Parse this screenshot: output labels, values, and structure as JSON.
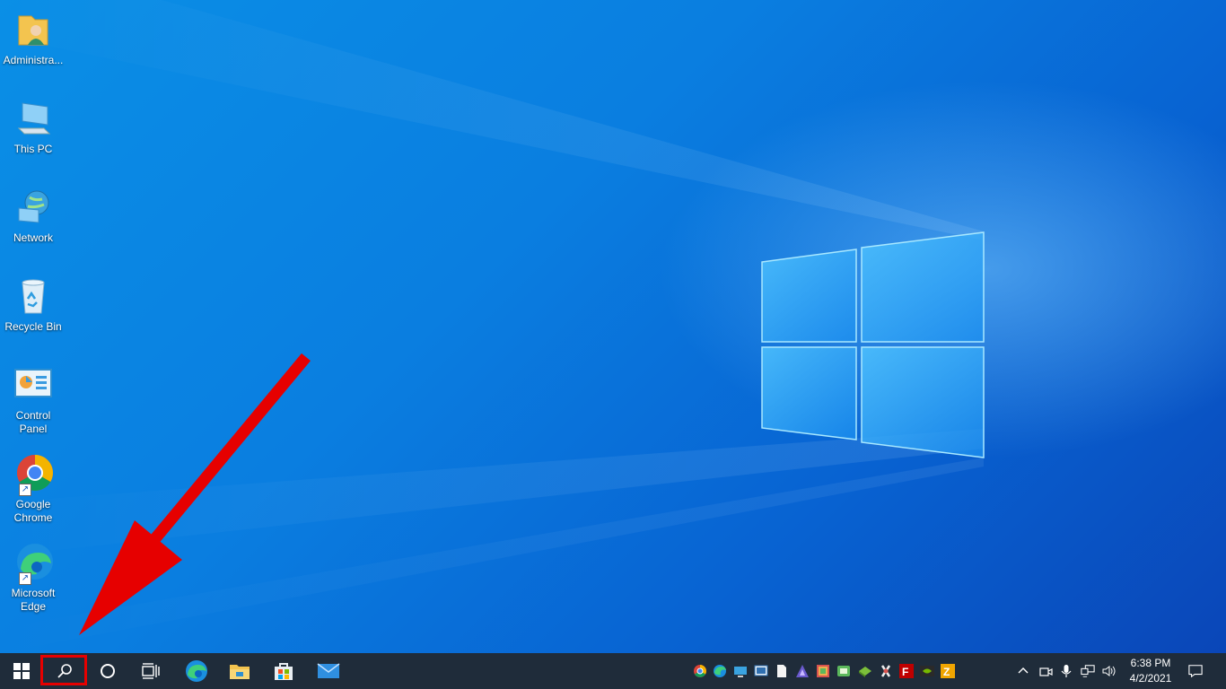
{
  "desktop": {
    "icons": [
      {
        "label": "Administra...",
        "icon": "user-folder-icon"
      },
      {
        "label": "This PC",
        "icon": "computer-icon"
      },
      {
        "label": "Network",
        "icon": "network-icon"
      },
      {
        "label": "Recycle Bin",
        "icon": "recycle-bin-icon"
      },
      {
        "label": "Control Panel",
        "icon": "control-panel-icon"
      },
      {
        "label": "Google Chrome",
        "icon": "chrome-icon"
      },
      {
        "label": "Microsoft Edge",
        "icon": "edge-icon"
      }
    ]
  },
  "annotation": {
    "color": "#e60000",
    "target": "search-button"
  },
  "taskbar": {
    "start": "windows-start-icon",
    "search": "search-icon",
    "cortana": "cortana-circle-icon",
    "task_view": "task-view-icon",
    "pinned": [
      "edge-icon",
      "file-explorer-icon",
      "store-icon",
      "mail-icon"
    ],
    "tray_apps": [
      "chrome-icon",
      "edge-icon",
      "monitor-icon",
      "remote-desktop-icon",
      "document-icon",
      "app-icon",
      "green-app-icon",
      "app-icon",
      "app-icon",
      "filezilla-icon",
      "nvidia-icon",
      "filezilla-z-icon"
    ],
    "system": [
      "chevron-up-icon",
      "meet-now-icon",
      "microphone-icon",
      "network-icon",
      "volume-icon"
    ],
    "clock": {
      "time": "6:38 PM",
      "date": "4/2/2021"
    },
    "notifications": "action-center-icon"
  }
}
